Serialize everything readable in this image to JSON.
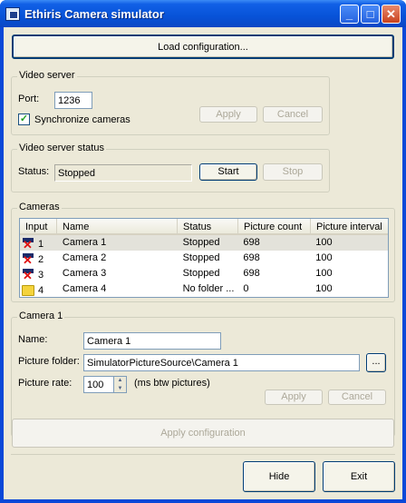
{
  "window": {
    "title": "Ethiris Camera simulator"
  },
  "titlebar_buttons": [
    "minimize-icon",
    "maximize-icon",
    "close-icon"
  ],
  "load_button": "Load configuration...",
  "video_server": {
    "group_label": "Video server",
    "port_label": "Port:",
    "port_value": "1236",
    "sync_label": "Synchronize cameras",
    "sync_checked": true,
    "apply": "Apply",
    "cancel": "Cancel"
  },
  "server_status": {
    "group_label": "Video server status",
    "status_label": "Status:",
    "status_value": "Stopped",
    "start": "Start",
    "stop": "Stop"
  },
  "cameras": {
    "group_label": "Cameras",
    "columns": [
      "Input",
      "Name",
      "Status",
      "Picture count",
      "Picture interval"
    ],
    "rows": [
      {
        "input": "1",
        "icon": "camera-error-icon",
        "name": "Camera 1",
        "status": "Stopped",
        "count": "698",
        "interval": "100"
      },
      {
        "input": "2",
        "icon": "camera-error-icon",
        "name": "Camera 2",
        "status": "Stopped",
        "count": "698",
        "interval": "100"
      },
      {
        "input": "3",
        "icon": "camera-error-icon",
        "name": "Camera 3",
        "status": "Stopped",
        "count": "698",
        "interval": "100"
      },
      {
        "input": "4",
        "icon": "folder-icon",
        "name": "Camera 4",
        "status": "No folder ...",
        "count": "0",
        "interval": "100"
      }
    ]
  },
  "camera_detail": {
    "group_label": "Camera 1",
    "name_label": "Name:",
    "name_value": "Camera 1",
    "folder_label": "Picture folder:",
    "folder_value": "SimulatorPictureSource\\Camera 1",
    "browse": "...",
    "rate_label": "Picture rate:",
    "rate_value": "100",
    "rate_unit": "(ms btw pictures)",
    "apply": "Apply",
    "cancel": "Cancel"
  },
  "apply_configuration": "Apply configuration",
  "hide": "Hide",
  "exit": "Exit"
}
